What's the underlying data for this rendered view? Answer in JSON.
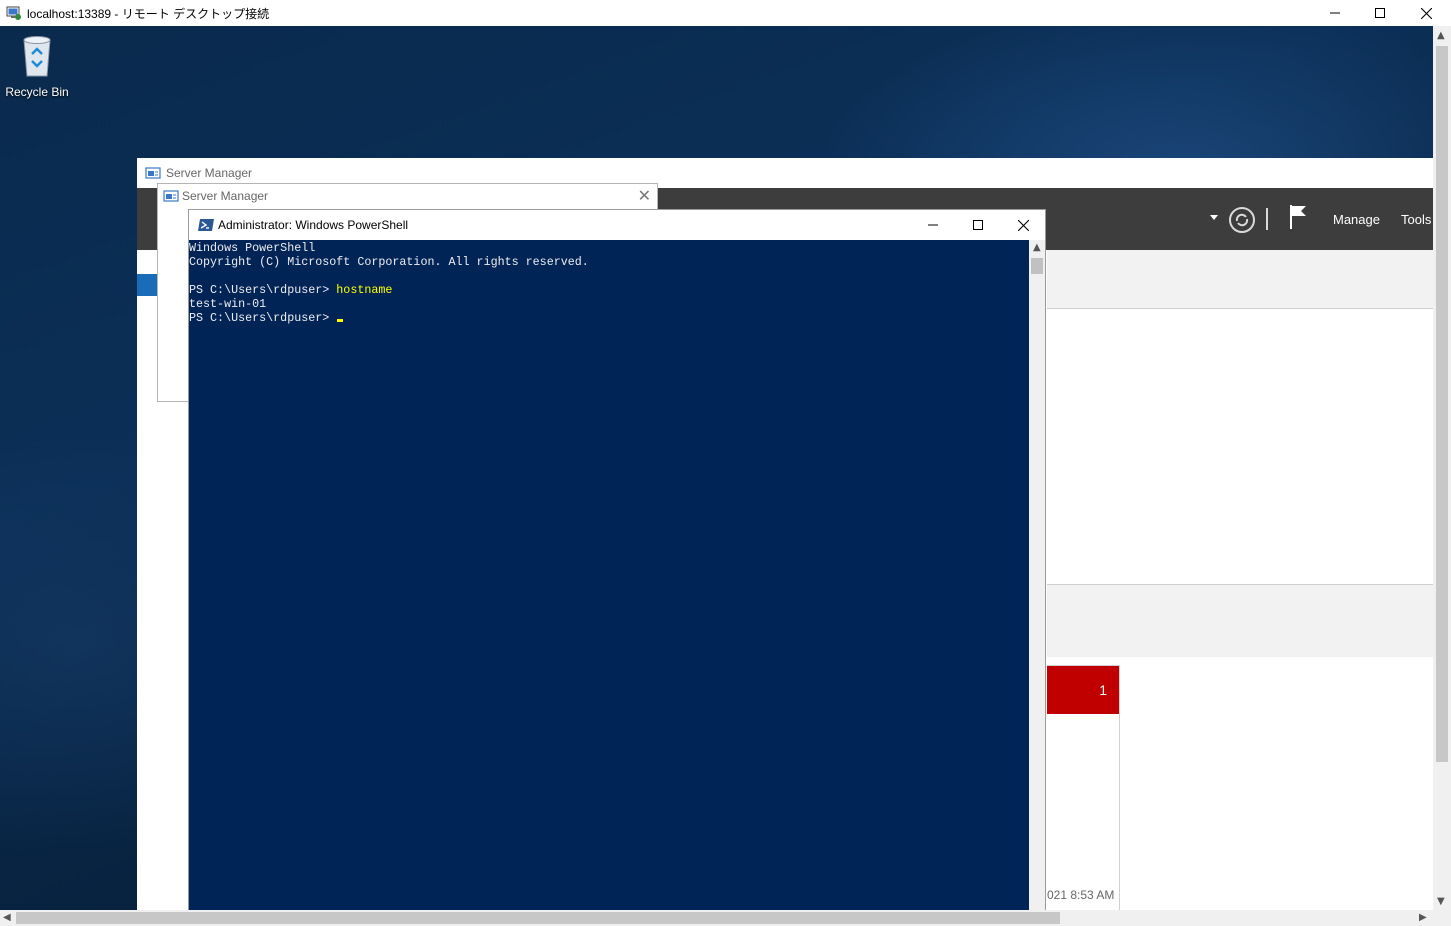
{
  "rdp_window": {
    "title": "localhost:13389 - リモート デスクトップ接続"
  },
  "desktop": {
    "recycle_bin_label": "Recycle Bin"
  },
  "server_manager_main": {
    "title": "Server Manager",
    "menu": {
      "manage": "Manage",
      "tools": "Tools"
    },
    "tile_count": "1",
    "tile_date": "021 8:53 AM"
  },
  "server_manager_dialog": {
    "title": "Server Manager"
  },
  "powershell": {
    "title": "Administrator: Windows PowerShell",
    "lines": {
      "l1": "Windows PowerShell",
      "l2": "Copyright (C) Microsoft Corporation. All rights reserved.",
      "l3": "",
      "l4_prompt": "PS C:\\Users\\rdpuser> ",
      "l4_cmd": "hostname",
      "l5": "test-win-01",
      "l6_prompt": "PS C:\\Users\\rdpuser> "
    }
  },
  "colors": {
    "ps_background": "#012456",
    "ps_text": "#eeedf0",
    "ps_command": "#ffff00",
    "sm_header": "#3d3d3d",
    "sm_alert": "#c00000"
  }
}
